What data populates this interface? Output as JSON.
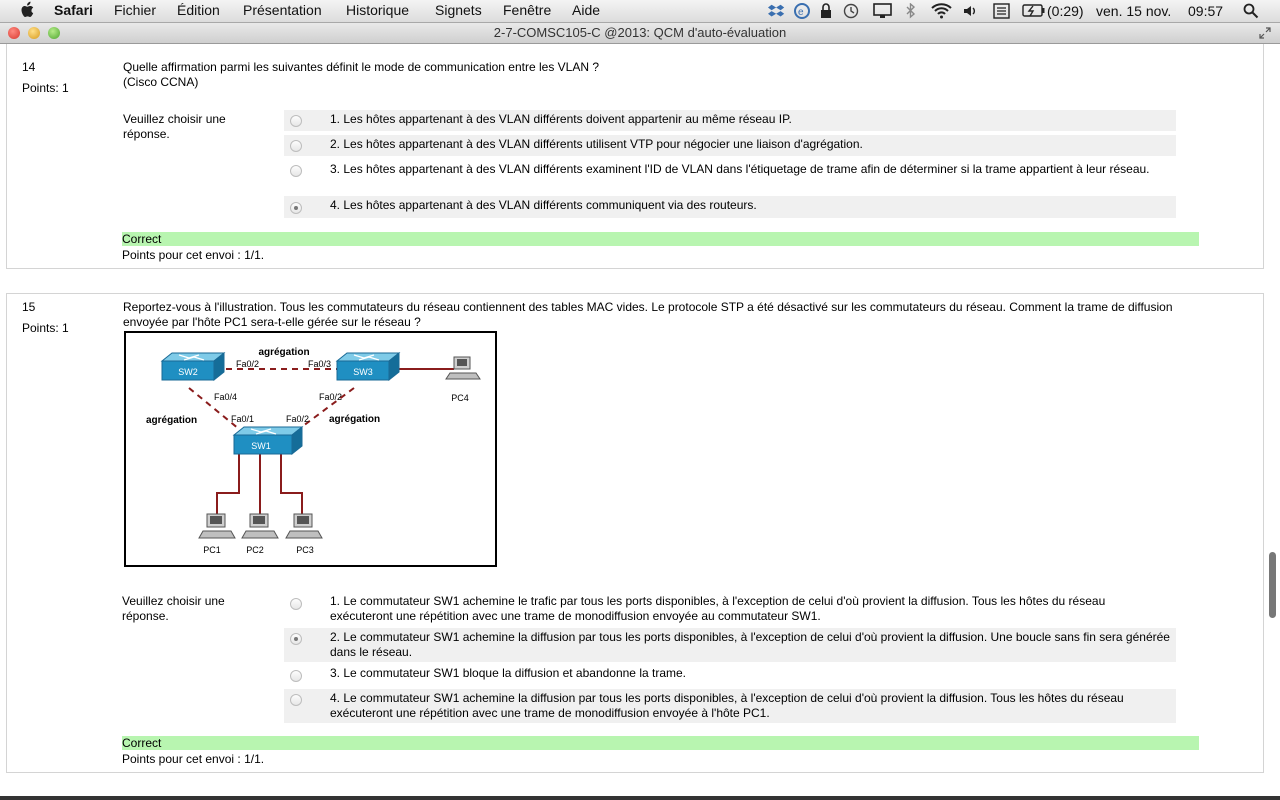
{
  "menubar": {
    "app": "Safari",
    "items": [
      "Fichier",
      "Édition",
      "Présentation",
      "Historique",
      "Signets",
      "Fenêtre",
      "Aide"
    ],
    "battery": "(0:29)",
    "date": "ven. 15 nov.",
    "time": "09:57"
  },
  "window": {
    "title": "2-7-COMSC105-C @2013: QCM d'auto-évaluation"
  },
  "q14": {
    "number": "14",
    "points": "Points: 1",
    "text1": "Quelle affirmation parmi les suivantes définit le mode de communication entre les VLAN ?",
    "text2": "(Cisco CCNA)",
    "prompt1": "Veuillez choisir une",
    "prompt2": "réponse.",
    "answers": [
      "1. Les hôtes appartenant à des VLAN différents doivent appartenir au même réseau IP.",
      "2. Les hôtes appartenant à des VLAN différents utilisent VTP pour négocier une liaison d'agrégation.",
      "3. Les hôtes appartenant à des VLAN différents examinent l'ID de VLAN dans l'étiquetage de trame afin de déterminer si la trame appartient à leur réseau.",
      "4. Les hôtes appartenant à des VLAN différents communiquent via des routeurs."
    ],
    "selected": 3,
    "feedback": "Correct",
    "score": "Points pour cet envoi : 1/1."
  },
  "q15": {
    "number": "15",
    "points": "Points: 1",
    "text": "Reportez-vous à l'illustration. Tous les commutateurs du réseau contiennent des tables MAC vides. Le protocole STP a été désactivé sur les commutateurs du réseau. Comment la trame de diffusion envoyée par l'hôte PC1 sera-t-elle gérée sur le réseau ?",
    "prompt1": "Veuillez choisir une",
    "prompt2": "réponse.",
    "diagram": {
      "sw1": "SW1",
      "sw2": "SW2",
      "sw3": "SW3",
      "pc1": "PC1",
      "pc2": "PC2",
      "pc3": "PC3",
      "pc4": "PC4",
      "agg_top": "agrégation",
      "agg_left": "agrégation",
      "agg_right": "agrégation",
      "sw2_fa02": "Fa0/2",
      "sw3_fa03": "Fa0/3",
      "sw2_fa04": "Fa0/4",
      "sw3_fa02": "Fa0/2",
      "sw1_fa01": "Fa0/1",
      "sw1_fa02": "Fa0/2"
    },
    "answers": [
      "1. Le commutateur SW1 achemine le trafic par tous les ports disponibles, à l'exception de celui d'où provient la diffusion. Tous les hôtes du réseau exécuteront une répétition avec une trame de monodiffusion envoyée au commutateur SW1.",
      "2. Le commutateur SW1 achemine la diffusion par tous les ports disponibles, à l'exception de celui d'où provient la diffusion. Une boucle sans fin sera générée dans le réseau.",
      "3. Le commutateur SW1 bloque la diffusion et abandonne la trame.",
      "4. Le commutateur SW1 achemine la diffusion par tous les ports disponibles, à l'exception de celui d'où provient la diffusion. Tous les hôtes du réseau exécuteront une répétition avec une trame de monodiffusion envoyée à l'hôte PC1."
    ],
    "selected": 1,
    "feedback": "Correct",
    "score": "Points pour cet envoi : 1/1."
  }
}
